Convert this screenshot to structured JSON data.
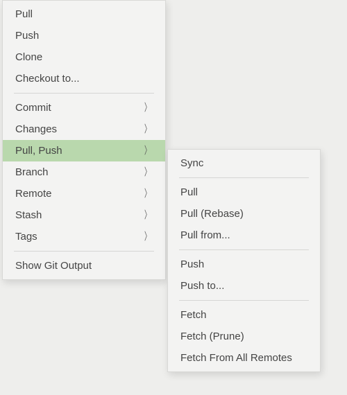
{
  "mainMenu": {
    "groups": [
      {
        "items": [
          {
            "id": "pull",
            "label": "Pull",
            "hasSubmenu": false
          },
          {
            "id": "push",
            "label": "Push",
            "hasSubmenu": false
          },
          {
            "id": "clone",
            "label": "Clone",
            "hasSubmenu": false
          },
          {
            "id": "checkout-to",
            "label": "Checkout to...",
            "hasSubmenu": false
          }
        ]
      },
      {
        "items": [
          {
            "id": "commit",
            "label": "Commit",
            "hasSubmenu": true
          },
          {
            "id": "changes",
            "label": "Changes",
            "hasSubmenu": true
          },
          {
            "id": "pull-push",
            "label": "Pull, Push",
            "hasSubmenu": true,
            "highlighted": true
          },
          {
            "id": "branch",
            "label": "Branch",
            "hasSubmenu": true
          },
          {
            "id": "remote",
            "label": "Remote",
            "hasSubmenu": true
          },
          {
            "id": "stash",
            "label": "Stash",
            "hasSubmenu": true
          },
          {
            "id": "tags",
            "label": "Tags",
            "hasSubmenu": true
          }
        ]
      },
      {
        "items": [
          {
            "id": "show-git-output",
            "label": "Show Git Output",
            "hasSubmenu": false
          }
        ]
      }
    ]
  },
  "subMenu": {
    "groups": [
      {
        "items": [
          {
            "id": "sync",
            "label": "Sync"
          }
        ]
      },
      {
        "items": [
          {
            "id": "sub-pull",
            "label": "Pull"
          },
          {
            "id": "pull-rebase",
            "label": "Pull (Rebase)"
          },
          {
            "id": "pull-from",
            "label": "Pull from..."
          }
        ]
      },
      {
        "items": [
          {
            "id": "sub-push",
            "label": "Push"
          },
          {
            "id": "push-to",
            "label": "Push to..."
          }
        ]
      },
      {
        "items": [
          {
            "id": "fetch",
            "label": "Fetch"
          },
          {
            "id": "fetch-prune",
            "label": "Fetch (Prune)"
          },
          {
            "id": "fetch-all",
            "label": "Fetch From All Remotes"
          }
        ]
      }
    ]
  },
  "chevron": "〉"
}
